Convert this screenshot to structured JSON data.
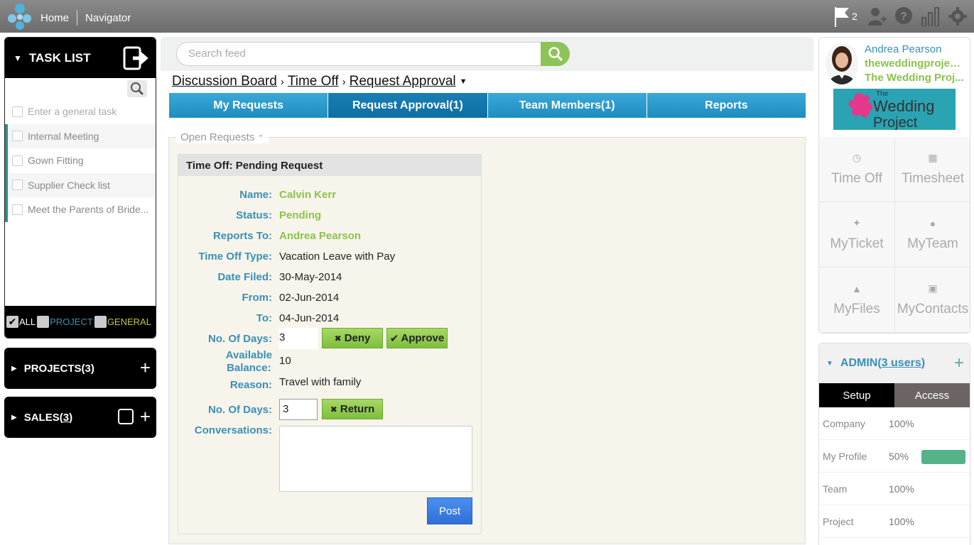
{
  "topbar": {
    "nav": [
      "Home",
      "Navigator"
    ],
    "flag_count": "2"
  },
  "tasklist": {
    "title": "TASK LIST",
    "new_task_placeholder": "Enter a general task",
    "items": [
      "Internal Meeting",
      "Gown Fitting",
      "Supplier Check list",
      "Meet the Parents of Bride..."
    ],
    "filters": {
      "all": "ALL",
      "project": "PROJECT",
      "general": "GENERAL"
    }
  },
  "panels": {
    "projects": "PROJECTS(3)",
    "sales_prefix": "SALES(",
    "sales_count": "3",
    "sales_suffix": ")"
  },
  "search": {
    "placeholder": "Search feed"
  },
  "breadcrumb": [
    "Discussion Board",
    "Time Off",
    "Request Approval"
  ],
  "tabs": [
    "My Requests",
    "Request Approval(1)",
    "Team Members(1)",
    "Reports"
  ],
  "open_requests": {
    "label": "Open Requests",
    "card_title": "Time Off: Pending Request",
    "fields": {
      "name_label": "Name:",
      "name": "Calvin Kerr",
      "status_label": "Status:",
      "status": "Pending",
      "reports_to_label": "Reports To:",
      "reports_to": "Andrea Pearson",
      "type_label": "Time Off Type:",
      "type": "Vacation Leave with Pay",
      "date_filed_label": "Date Filed:",
      "date_filed": "30-May-2014",
      "from_label": "From:",
      "from": "02-Jun-2014",
      "to_label": "To:",
      "to": "04-Jun-2014",
      "days_label": "No. Of Days:",
      "days": "3",
      "balance_label_1": "Available",
      "balance_label_2": "Balance:",
      "balance": "10",
      "reason_label": "Reason:",
      "reason": "Travel with family",
      "days2_label": "No. Of Days:",
      "days2": "3",
      "conversations_label": "Conversations:"
    },
    "buttons": {
      "deny": "Deny",
      "approve": "Approve",
      "return": "Return",
      "post": "Post"
    }
  },
  "profile": {
    "name": "Andrea Pearson",
    "site": "theweddingproject...",
    "company": "The Wedding Proj...",
    "banner_text_top": "The",
    "banner_text_main": "Wedding",
    "banner_text_sub": "Project",
    "tiles": [
      "Time Off",
      "Timesheet",
      "MyTicket",
      "MyTeam",
      "MyFiles",
      "MyContacts"
    ]
  },
  "admin": {
    "title_prefix": "ADMIN(",
    "users_link": "3 users",
    "title_suffix": ")",
    "tabs": [
      "Setup",
      "Access"
    ],
    "rows": [
      {
        "label": "Company",
        "pct": "100%"
      },
      {
        "label": "My Profile",
        "pct": "50%"
      },
      {
        "label": "Team",
        "pct": "100%"
      },
      {
        "label": "Project",
        "pct": "100%"
      }
    ],
    "profile_progress": 0.5
  },
  "colors": {
    "accent_blue": "#3a8fb7",
    "accent_green": "#8bc34a",
    "tab_blue": "#1e8cc0",
    "progress_green": "#55b38a"
  }
}
